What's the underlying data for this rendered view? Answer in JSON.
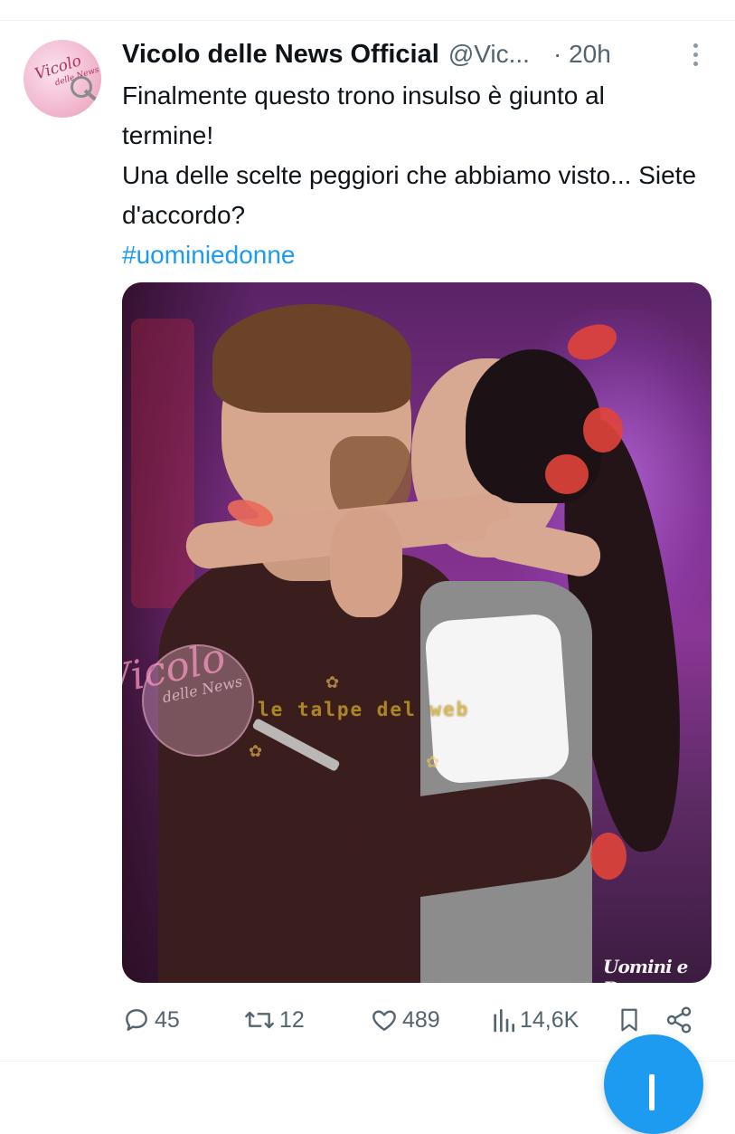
{
  "tweet": {
    "author": {
      "display_name": "Vicolo delle News Official",
      "handle": "@Vic...",
      "avatar_icon": "vicolo-delle-news-logo",
      "avatar_text": "Vicolo",
      "avatar_subtext": "delle News"
    },
    "time": "· 20h",
    "text_lines": [
      "Finalmente questo trono insulso è giunto al termine!",
      "Una delle scelte peggiori che abbiamo visto... Siete d'accordo?"
    ],
    "hashtag": "#uominiedonne",
    "media": {
      "description_icon": "photo",
      "watermark_main": "Vicolo",
      "watermark_sub": "delle News",
      "watermark_secondary": "le talpe del web",
      "program_logo": "Uomini e Donne"
    },
    "actions": {
      "reply_count": "45",
      "retweet_count": "12",
      "like_count": "489",
      "views_count": "14,6K"
    }
  },
  "colors": {
    "accent": "#1d9bf0",
    "text_primary": "#0f1419",
    "text_secondary": "#536471"
  }
}
